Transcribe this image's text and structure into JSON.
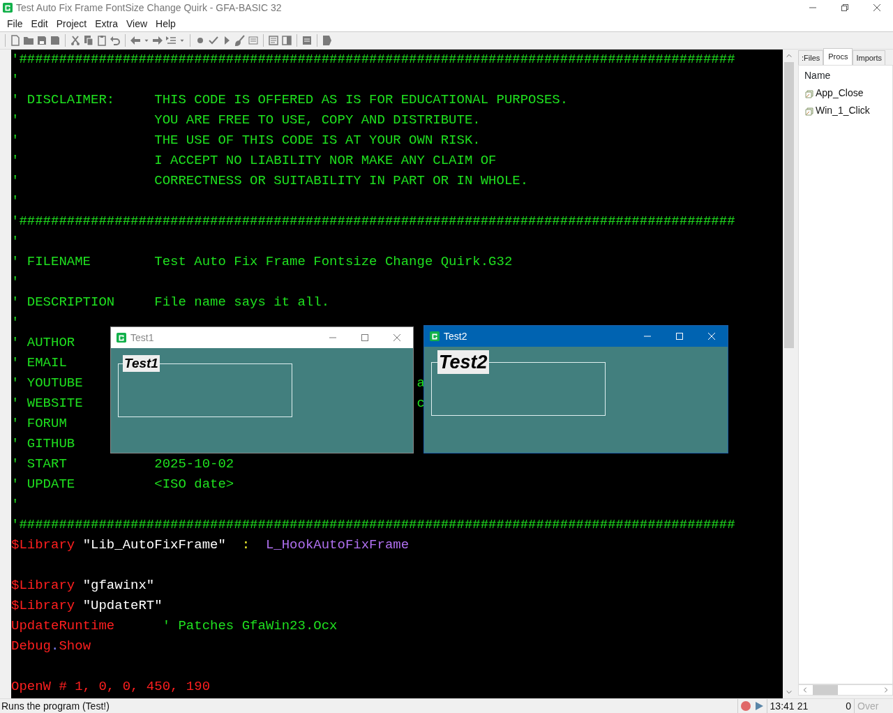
{
  "window": {
    "title": "Test Auto Fix Frame FontSize Change Quirk - GFA-BASIC 32"
  },
  "menu": [
    "File",
    "Edit",
    "Project",
    "Extra",
    "View",
    "Help"
  ],
  "editor": {
    "lines": [
      {
        "kind": "code",
        "segments": [
          {
            "kind": "comment",
            "text": "'##########################################################################################"
          }
        ]
      },
      {
        "kind": "code",
        "segments": [
          {
            "kind": "comment",
            "text": "'"
          }
        ]
      },
      {
        "kind": "code",
        "segments": [
          {
            "kind": "comment",
            "text": "' DISCLAIMER:     THIS CODE IS OFFERED AS IS FOR EDUCATIONAL PURPOSES."
          }
        ]
      },
      {
        "kind": "code",
        "segments": [
          {
            "kind": "comment",
            "text": "'                 YOU ARE FREE TO USE, COPY AND DISTRIBUTE."
          }
        ]
      },
      {
        "kind": "code",
        "segments": [
          {
            "kind": "comment",
            "text": "'                 THE USE OF THIS CODE IS AT YOUR OWN RISK."
          }
        ]
      },
      {
        "kind": "code",
        "segments": [
          {
            "kind": "comment",
            "text": "'                 I ACCEPT NO LIABILITY NOR MAKE ANY CLAIM OF"
          }
        ]
      },
      {
        "kind": "code",
        "segments": [
          {
            "kind": "comment",
            "text": "'                 CORRECTNESS OR SUITABILITY IN PART OR IN WHOLE."
          }
        ]
      },
      {
        "kind": "code",
        "segments": [
          {
            "kind": "comment",
            "text": "'"
          }
        ]
      },
      {
        "kind": "code",
        "segments": [
          {
            "kind": "comment",
            "text": "'##########################################################################################"
          }
        ]
      },
      {
        "kind": "code",
        "segments": [
          {
            "kind": "comment",
            "text": "'"
          }
        ]
      },
      {
        "kind": "code",
        "segments": [
          {
            "kind": "comment",
            "text": "' FILENAME        Test Auto Fix Frame Fontsize Change Quirk.G32"
          }
        ]
      },
      {
        "kind": "code",
        "segments": [
          {
            "kind": "comment",
            "text": "'"
          }
        ]
      },
      {
        "kind": "code",
        "segments": [
          {
            "kind": "comment",
            "text": "' DESCRIPTION     File name says it all."
          }
        ]
      },
      {
        "kind": "code",
        "segments": [
          {
            "kind": "comment",
            "text": "'"
          }
        ]
      },
      {
        "kind": "code",
        "segments": [
          {
            "kind": "comment",
            "text": "' AUTHOR"
          }
        ]
      },
      {
        "kind": "code",
        "segments": [
          {
            "kind": "comment",
            "text": "' EMAIL"
          }
        ]
      },
      {
        "kind": "code",
        "segments": [
          {
            "kind": "comment",
            "text": "' YOUTUBE"
          },
          {
            "kind": "comment",
            "text": "                                          a"
          }
        ]
      },
      {
        "kind": "code",
        "segments": [
          {
            "kind": "comment",
            "text": "' WEBSITE"
          },
          {
            "kind": "comment",
            "text": "                                          c"
          }
        ]
      },
      {
        "kind": "code",
        "segments": [
          {
            "kind": "comment",
            "text": "' FORUM"
          }
        ]
      },
      {
        "kind": "code",
        "segments": [
          {
            "kind": "comment",
            "text": "' GITHUB"
          }
        ]
      },
      {
        "kind": "code",
        "segments": [
          {
            "kind": "comment",
            "text": "' START           2025-10-02"
          }
        ]
      },
      {
        "kind": "code",
        "segments": [
          {
            "kind": "comment",
            "text": "' UPDATE          <ISO date>"
          }
        ]
      },
      {
        "kind": "code",
        "segments": [
          {
            "kind": "comment",
            "text": "'"
          }
        ]
      },
      {
        "kind": "code",
        "segments": [
          {
            "kind": "comment",
            "text": "'##########################################################################################"
          }
        ]
      },
      {
        "kind": "code",
        "segments": [
          {
            "kind": "keyword",
            "text": "$Library"
          },
          {
            "kind": "string",
            "text": " \"Lib_AutoFixFrame\""
          },
          {
            "kind": "operator",
            "text": "  :"
          },
          {
            "kind": "procedure",
            "text": "  L_HookAutoFixFrame"
          }
        ]
      },
      {
        "kind": "blank"
      },
      {
        "kind": "code",
        "segments": [
          {
            "kind": "keyword",
            "text": "$Library"
          },
          {
            "kind": "string",
            "text": " \"gfawinx\""
          }
        ]
      },
      {
        "kind": "code",
        "segments": [
          {
            "kind": "keyword",
            "text": "$Library"
          },
          {
            "kind": "string",
            "text": " \"UpdateRT\""
          }
        ]
      },
      {
        "kind": "code",
        "segments": [
          {
            "kind": "keyword",
            "text": "UpdateRuntime"
          },
          {
            "kind": "comment",
            "text": "      ' Patches GfaWin23.Ocx"
          }
        ]
      },
      {
        "kind": "code",
        "segments": [
          {
            "kind": "keyword",
            "text": "Debug"
          },
          {
            "kind": "operator-dot",
            "text": "."
          },
          {
            "kind": "keyword",
            "text": "Show"
          }
        ]
      },
      {
        "kind": "blank"
      },
      {
        "kind": "code",
        "segments": [
          {
            "kind": "keyword",
            "text": "OpenW # 1, 0, 0, 450, 190"
          }
        ]
      }
    ]
  },
  "windows": [
    {
      "title": "Test1",
      "active": false,
      "kind": "normal",
      "frame_label": "Test1"
    },
    {
      "title": "Test2",
      "active": true,
      "kind": "enlarged",
      "frame_label": "Test2"
    }
  ],
  "side_panel": {
    "tabs": [
      {
        "label": ":Files",
        "selected": false
      },
      {
        "label": "Procs",
        "selected": true
      },
      {
        "label": "Imports",
        "selected": false
      }
    ],
    "header": "Name",
    "items": [
      "App_Close",
      "Win_1_Click"
    ]
  },
  "status_bar": {
    "message": "Runs the program (Test!)",
    "time": "13:41",
    "line": "21",
    "column": "0",
    "mode": "Over",
    "mode_disabled": true
  }
}
